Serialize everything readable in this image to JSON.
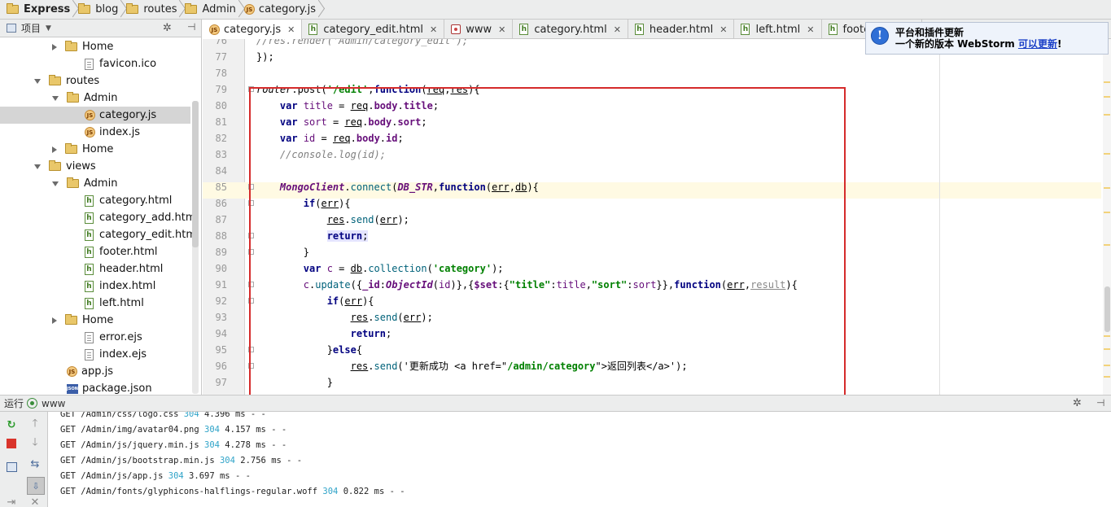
{
  "breadcrumb": [
    "Express",
    "blog",
    "routes",
    "Admin",
    "category.js"
  ],
  "sidebar": {
    "title": "项目",
    "items": [
      {
        "label": "Home",
        "type": "folder",
        "state": "collapsed",
        "indent": 1
      },
      {
        "label": "favicon.ico",
        "type": "file",
        "indent": 2
      },
      {
        "label": "routes",
        "type": "folder",
        "state": "expanded",
        "indent": 0
      },
      {
        "label": "Admin",
        "type": "folder",
        "state": "expanded",
        "indent": 1
      },
      {
        "label": "category.js",
        "type": "js",
        "indent": 2,
        "selected": true
      },
      {
        "label": "index.js",
        "type": "js",
        "indent": 2
      },
      {
        "label": "Home",
        "type": "folder",
        "state": "collapsed",
        "indent": 1
      },
      {
        "label": "views",
        "type": "folder",
        "state": "expanded",
        "indent": 0
      },
      {
        "label": "Admin",
        "type": "folder",
        "state": "expanded",
        "indent": 1
      },
      {
        "label": "category.html",
        "type": "html",
        "indent": 2
      },
      {
        "label": "category_add.html",
        "type": "html",
        "indent": 2
      },
      {
        "label": "category_edit.html",
        "type": "html",
        "indent": 2
      },
      {
        "label": "footer.html",
        "type": "html",
        "indent": 2
      },
      {
        "label": "header.html",
        "type": "html",
        "indent": 2
      },
      {
        "label": "index.html",
        "type": "html",
        "indent": 2
      },
      {
        "label": "left.html",
        "type": "html",
        "indent": 2
      },
      {
        "label": "Home",
        "type": "folder",
        "state": "collapsed",
        "indent": 1
      },
      {
        "label": "error.ejs",
        "type": "file",
        "indent": 2
      },
      {
        "label": "index.ejs",
        "type": "file",
        "indent": 2
      },
      {
        "label": "app.js",
        "type": "js",
        "indent": 0
      },
      {
        "label": "package.json",
        "type": "json",
        "indent": 0
      }
    ]
  },
  "tabs": [
    {
      "label": "category.js",
      "type": "js",
      "active": true
    },
    {
      "label": "category_edit.html",
      "type": "html"
    },
    {
      "label": "www",
      "type": "www"
    },
    {
      "label": "category.html",
      "type": "html"
    },
    {
      "label": "header.html",
      "type": "html"
    },
    {
      "label": "left.html",
      "type": "html"
    },
    {
      "label": "footer.html",
      "type": "html"
    }
  ],
  "notification": {
    "title": "平台和插件更新",
    "body": "一个新的版本 WebStorm ",
    "link": "可以更新",
    "suffix": "!"
  },
  "editor": {
    "line_numbers": [
      "76",
      "77",
      "78",
      "79",
      "80",
      "81",
      "82",
      "83",
      "84",
      "85",
      "86",
      "87",
      "88",
      "89",
      "90",
      "91",
      "92",
      "93",
      "94",
      "95",
      "96",
      "97"
    ]
  },
  "run": {
    "label": "运行",
    "config": "www",
    "log": [
      {
        "text": "GET /Admin/css/logo.css ",
        "code": "304",
        "rest": " 4.396 ms - -"
      },
      {
        "text": "GET /Admin/img/avatar04.png ",
        "code": "304",
        "rest": " 4.157 ms - -"
      },
      {
        "text": "GET /Admin/js/jquery.min.js ",
        "code": "304",
        "rest": " 4.278 ms - -"
      },
      {
        "text": "GET /Admin/js/bootstrap.min.js ",
        "code": "304",
        "rest": " 2.756 ms - -"
      },
      {
        "text": "GET /Admin/js/app.js ",
        "code": "304",
        "rest": " 3.697 ms - -"
      },
      {
        "text": "GET /Admin/fonts/glyphicons-halflings-regular.woff ",
        "code": "304",
        "rest": " 0.822 ms - -"
      }
    ]
  },
  "colors": {
    "accent": "#d52b2b",
    "highlight_line": "#fffae3",
    "status_code": "#2fa3c8"
  }
}
